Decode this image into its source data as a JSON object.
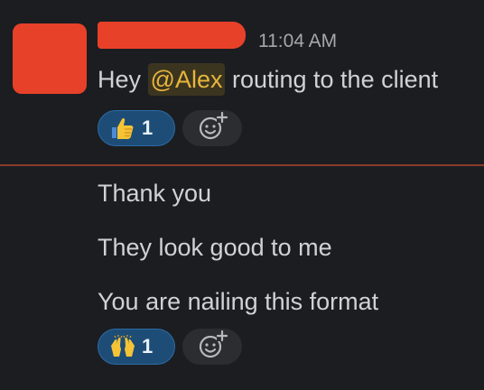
{
  "message1": {
    "timestamp": "11:04 AM",
    "text_before": "Hey ",
    "mention": "@Alex",
    "text_after": " routing to the client",
    "reaction": {
      "emoji": "thumbs-up",
      "count": "1"
    }
  },
  "message2": {
    "text": "Thank you"
  },
  "message3": {
    "text": "They look good to me"
  },
  "message4": {
    "text": "You are nailing this format",
    "reaction": {
      "emoji": "raised-hands",
      "count": "1"
    }
  },
  "colors": {
    "background": "#1b1d21",
    "redaction": "#e8412a",
    "mention_text": "#e8b53c",
    "reaction_bg": "#1d4d76",
    "divider": "#8a3b2c"
  }
}
